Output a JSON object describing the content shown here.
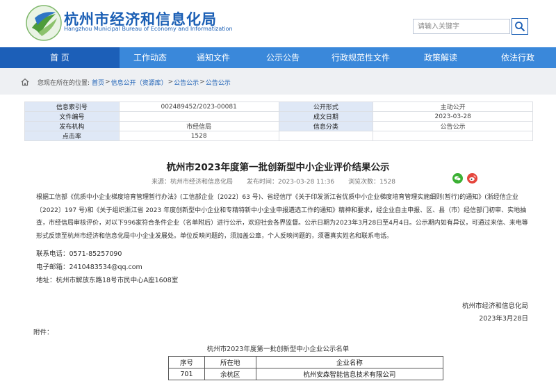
{
  "header": {
    "title": "杭州市经济和信息化局",
    "subtitle": "Hangzhou Municipal Bureau of Economy and Informatization",
    "search_placeholder": "请输入关键字",
    "brand_color": "#1b5fb5"
  },
  "nav": {
    "items": [
      {
        "label": "首 页",
        "active": true
      },
      {
        "label": "工作动态",
        "active": false
      },
      {
        "label": "通知文件",
        "active": false
      },
      {
        "label": "公示公告",
        "active": false
      },
      {
        "label": "行政规范性文件",
        "active": false
      },
      {
        "label": "政策解读",
        "active": false
      },
      {
        "label": "依法行政",
        "active": false
      }
    ],
    "bg_color": "#3a88da",
    "active_color": "#1c5fb8"
  },
  "breadcrumb": {
    "prefix": "您现在所在的位置:",
    "items": [
      "首页",
      "信息公开（资源库）",
      "公告公示",
      "公告公示"
    ],
    "separator": ">"
  },
  "info_table": [
    [
      "信息索引号",
      "002489452/2023-00081",
      "公开形式",
      "主动公开"
    ],
    [
      "文件编号",
      "",
      "成文日期",
      "2023-03-28"
    ],
    [
      "发布机构",
      "市经信局",
      "信息分类",
      "公告公示"
    ],
    [
      "点击率",
      "1528",
      "",
      ""
    ]
  ],
  "article": {
    "title": "杭州市2023年度第一批创新型中小企业评价结果公示",
    "source": "来源：杭州市经济和信息化局",
    "publish_time": "发布时间：2023-03-28 11:36",
    "views": "浏览次数：1528",
    "body": "根据工信部《优质中小企业梯度培育管理暂行办法》(工信部企业〔2022〕63 号)、省经信厅《关于印发浙江省优质中小企业梯度培育管理实施细则(暂行)的通知》(浙经信企业〔2022〕197 号)和《关于组织浙江省 2023 年度创新型中小企业和专精特新中小企业申报遴选工作的通知》精神和要求，经企业自主申报、区、县（市）经信部门初审、实地抽查，市经信局审核评价，对以下996家符合条件企业（名单附后）进行公示，欢迎社会各界监督。公示日期为2023年3月28日至4月4日。公示期内如有异议，可通过来信、来电等形式反馈至杭州市经济和信息化局中小企业发展处。单位反映问题的，须加盖公章，个人反映问题的，须署真实姓名和联系电话。",
    "contact_phone": "联系电话：0571-85257090",
    "email": "电子邮箱：2410483534@qq.com",
    "address": "地址：杭州市解放东路18号市民中心A座1608室",
    "sign_org": "杭州市经济和信息化局",
    "sign_date": "2023年3月28日",
    "attachment_label": "附件："
  },
  "company_list": {
    "title": "杭州市2023年度第一批创新型中小企业公示名单",
    "headers": [
      "序号",
      "所在地",
      "企业名称"
    ],
    "rows": [
      [
        "701",
        "余杭区",
        "杭州安森智能信息技术有限公司"
      ]
    ]
  },
  "share_icons": [
    "wechat-icon",
    "weibo-icon"
  ]
}
